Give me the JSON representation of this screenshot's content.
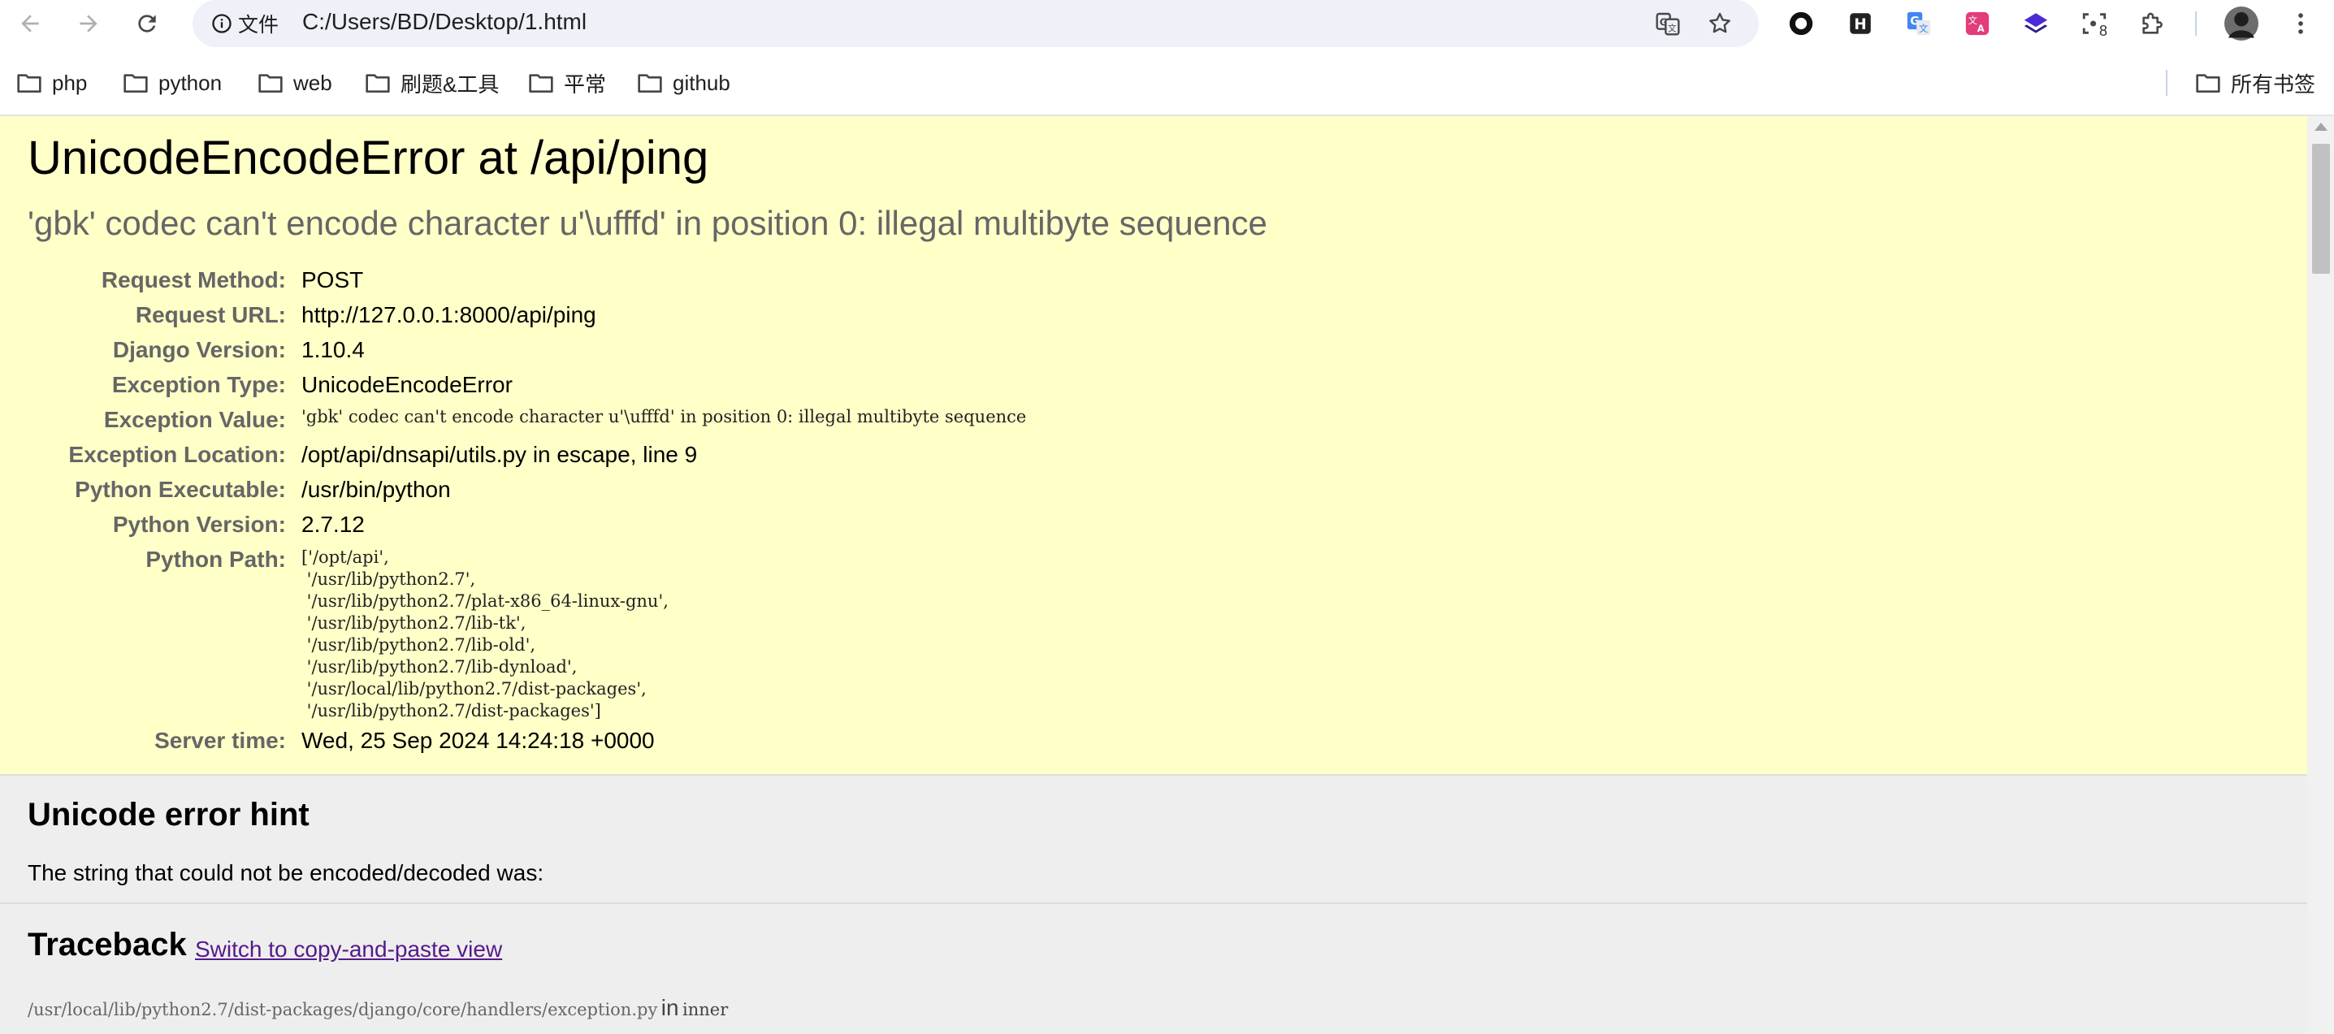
{
  "browser": {
    "site_info_label": "文件",
    "url": "C:/Users/BD/Desktop/1.html",
    "extensions": [
      {
        "icon": "circle-record-icon"
      },
      {
        "icon": "h-letter-icon",
        "text": "H"
      },
      {
        "icon": "google-translate-icon"
      },
      {
        "icon": "translate-pink-icon"
      },
      {
        "icon": "layers-purple-icon"
      },
      {
        "icon": "screenshot-icon",
        "badge": "8"
      },
      {
        "icon": "puzzle-icon"
      }
    ]
  },
  "bookmarks": {
    "items": [
      "php",
      "python",
      "web",
      "刷题&工具",
      "平常",
      "github"
    ],
    "all_bookmarks": "所有书签"
  },
  "error": {
    "title": "UnicodeEncodeError at /api/ping",
    "subtitle": "'gbk' codec can't encode character u'\\ufffd' in position 0: illegal multibyte sequence",
    "meta": [
      {
        "label": "Request Method:",
        "value": "POST"
      },
      {
        "label": "Request URL:",
        "value": "http://127.0.0.1:8000/api/ping"
      },
      {
        "label": "Django Version:",
        "value": "1.10.4"
      },
      {
        "label": "Exception Type:",
        "value": "UnicodeEncodeError"
      },
      {
        "label": "Exception Value:",
        "value": "'gbk' codec can't encode character u'\\ufffd' in position 0: illegal multibyte sequence"
      },
      {
        "label": "Exception Location:",
        "value": "/opt/api/dnsapi/utils.py in escape, line 9"
      },
      {
        "label": "Python Executable:",
        "value": "/usr/bin/python"
      },
      {
        "label": "Python Version:",
        "value": "2.7.12"
      },
      {
        "label": "Python Path:",
        "value": ""
      },
      {
        "label": "Server time:",
        "value": "Wed, 25 Sep 2024 14:24:18 +0000"
      }
    ],
    "python_path": [
      "['/opt/api',",
      " '/usr/lib/python2.7',",
      " '/usr/lib/python2.7/plat-x86_64-linux-gnu',",
      " '/usr/lib/python2.7/lib-tk',",
      " '/usr/lib/python2.7/lib-old',",
      " '/usr/lib/python2.7/lib-dynload',",
      " '/usr/local/lib/python2.7/dist-packages',",
      " '/usr/lib/python2.7/dist-packages']"
    ]
  },
  "hint": {
    "title": "Unicode error hint",
    "text": "The string that could not be encoded/decoded was:"
  },
  "traceback": {
    "title": "Traceback",
    "link": "Switch to copy-and-paste view",
    "frame_file": "/usr/local/lib/python2.7/dist-packages/django/core/handlers/exception.py",
    "frame_in": "in",
    "frame_function": "inner"
  }
}
